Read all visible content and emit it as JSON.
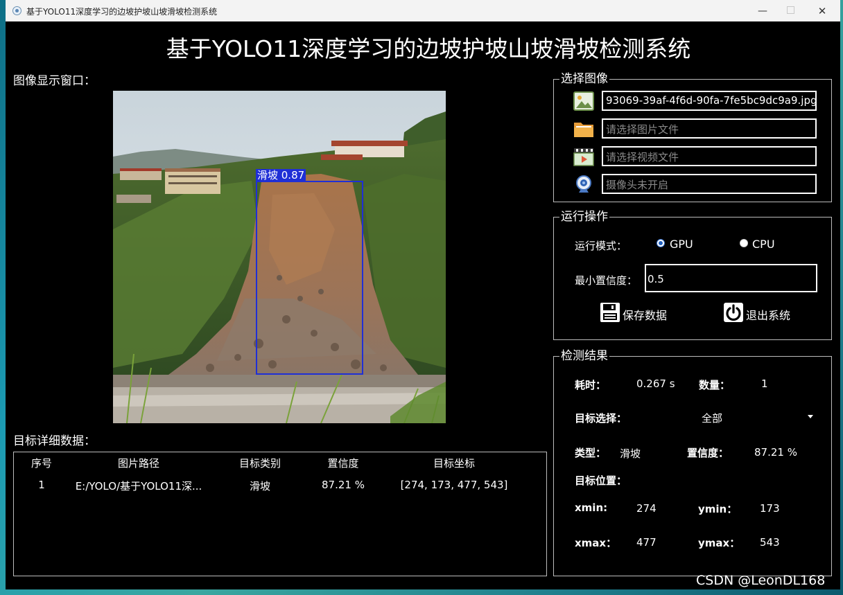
{
  "window": {
    "title": "基于YOLO11深度学习的边坡护坡山坡滑坡检测系统"
  },
  "header": {
    "title": "基于YOLO11深度学习的边坡护坡山坡滑坡检测系统"
  },
  "viewer": {
    "label": "图像显示窗口："
  },
  "detection_box": {
    "label": "滑坡 0.87",
    "color": "#1f2fd6"
  },
  "details": {
    "label": "目标详细数据：",
    "columns": [
      "序号",
      "图片路径",
      "目标类别",
      "置信度",
      "目标坐标"
    ],
    "rows": [
      {
        "index": "1",
        "path": "E:/YOLO/基于YOLO11深...",
        "class": "滑坡",
        "confidence": "87.21 %",
        "coords": "[274, 173, 477, 543]"
      }
    ]
  },
  "select_image": {
    "title": "选择图像",
    "image_value": "93069-39af-4f6d-90fa-7fe5bc9dc9a9.jpg",
    "folder_placeholder": "请选择图片文件",
    "video_placeholder": "请选择视频文件",
    "camera_placeholder": "摄像头未开启"
  },
  "run": {
    "title": "运行操作",
    "mode_label": "运行模式：",
    "gpu_label": "GPU",
    "cpu_label": "CPU",
    "selected_mode": "GPU",
    "conf_label": "最小置信度：",
    "conf_value": "0.5",
    "save_label": "保存数据",
    "exit_label": "退出系统"
  },
  "result": {
    "title": "检测结果",
    "time_label": "耗时：",
    "time_value": "0.267 s",
    "count_label": "数量：",
    "count_value": "1",
    "target_label": "目标选择：",
    "target_value": "全部",
    "type_label": "类型：",
    "type_value": "滑坡",
    "conf_label": "置信度：",
    "conf_value": "87.21 %",
    "position_label": "目标位置：",
    "xmin_label": "xmin:",
    "xmin_value": "274",
    "ymin_label": "ymin：",
    "ymin_value": "173",
    "xmax_label": "xmax：",
    "xmax_value": "477",
    "ymax_label": "ymax：",
    "ymax_value": "543"
  },
  "watermark": "CSDN @LeonDL168"
}
